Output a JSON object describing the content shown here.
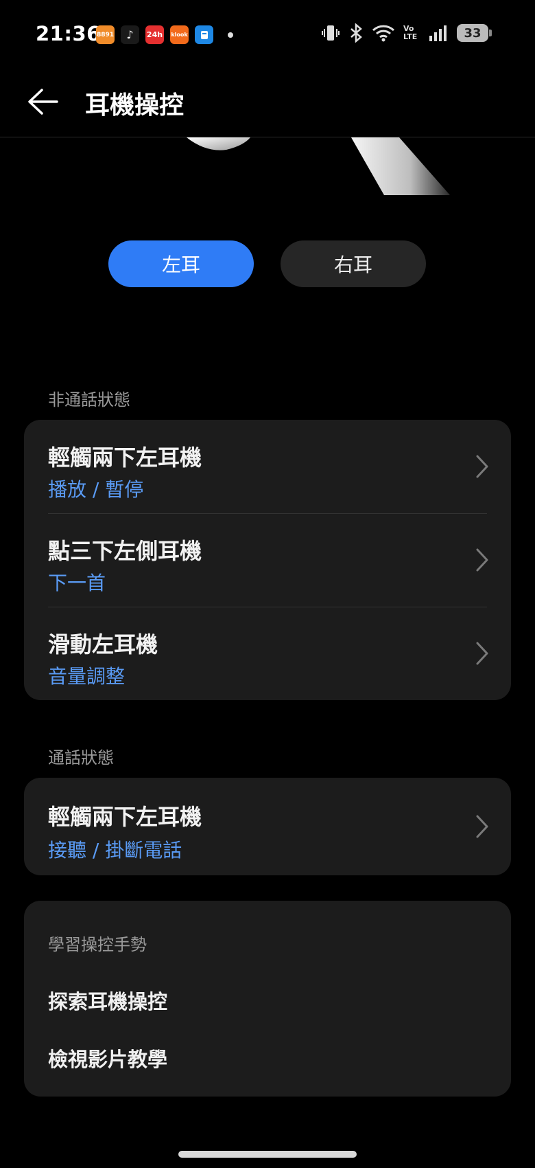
{
  "status_bar": {
    "time": "21:36",
    "notif_apps": [
      {
        "name": "8891-app-icon",
        "label": "8891",
        "color": "#f08c2a"
      },
      {
        "name": "tiktok-app-icon",
        "label": "♪",
        "color": "#1a1a1a"
      },
      {
        "name": "24h-app-icon",
        "label": "24h",
        "color": "#e53030"
      },
      {
        "name": "klook-app-icon",
        "label": "klook",
        "color": "#f26a1b"
      },
      {
        "name": "app-icon-blue",
        "label": "",
        "color": "#1e88e5"
      }
    ],
    "volte_label": "Vo LTE",
    "battery_level": "33"
  },
  "header": {
    "title": "耳機操控"
  },
  "ear_selector": {
    "left_label": "左耳",
    "right_label": "右耳",
    "selected": "left"
  },
  "non_call": {
    "section_label": "非通話狀態",
    "items": [
      {
        "title": "輕觸兩下左耳機",
        "value": "播放 / 暫停"
      },
      {
        "title": "點三下左側耳機",
        "value": "下一首"
      },
      {
        "title": "滑動左耳機",
        "value": "音量調整"
      }
    ]
  },
  "call": {
    "section_label": "通話狀態",
    "items": [
      {
        "title": "輕觸兩下左耳機",
        "value": "接聽 / 掛斷電話"
      }
    ]
  },
  "learn": {
    "header": "學習操控手勢",
    "items": [
      "探索耳機操控",
      "檢視影片教學"
    ]
  },
  "colors": {
    "accent": "#2f7cf6",
    "value_text": "#5a9bf5",
    "card_bg": "#1c1c1c"
  }
}
